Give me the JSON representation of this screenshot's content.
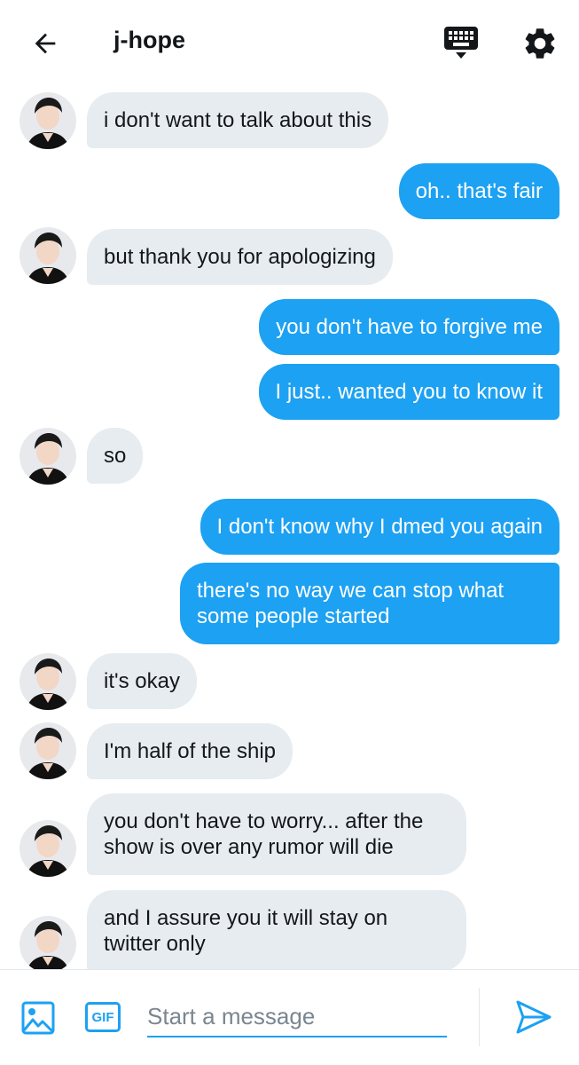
{
  "header": {
    "title": "j-hope",
    "back_icon": "arrow-left-icon",
    "keyboard_icon": "keyboard-icon",
    "settings_icon": "gear-icon"
  },
  "colors": {
    "accent": "#1da1f2",
    "incoming_bubble": "#e6ecf0",
    "text": "#14171a"
  },
  "messages": [
    {
      "from": "them",
      "text": "i don't want to talk about this"
    },
    {
      "from": "me",
      "text": "oh.. that's fair"
    },
    {
      "from": "them",
      "text": "but thank you for apologizing"
    },
    {
      "from": "me",
      "text": "you don't have to forgive me"
    },
    {
      "from": "me",
      "text": "I just.. wanted you to know it"
    },
    {
      "from": "them",
      "text": "so"
    },
    {
      "from": "me",
      "text": "I don't know why I dmed you again"
    },
    {
      "from": "me",
      "line1": "there's no way we can stop what",
      "line2": "some people started"
    },
    {
      "from": "them",
      "text": "it's okay"
    },
    {
      "from": "them",
      "text": "I'm half of the ship"
    },
    {
      "from": "them",
      "line1": "you don't have to worry... after the",
      "line2": "show is over any rumor will die"
    },
    {
      "from": "them",
      "line1": "and I assure you it will stay on",
      "line2": "twitter only"
    }
  ],
  "composer": {
    "placeholder": "Start a message",
    "value": "",
    "gif_label": "GIF",
    "image_icon": "image-icon",
    "send_icon": "send-icon"
  }
}
